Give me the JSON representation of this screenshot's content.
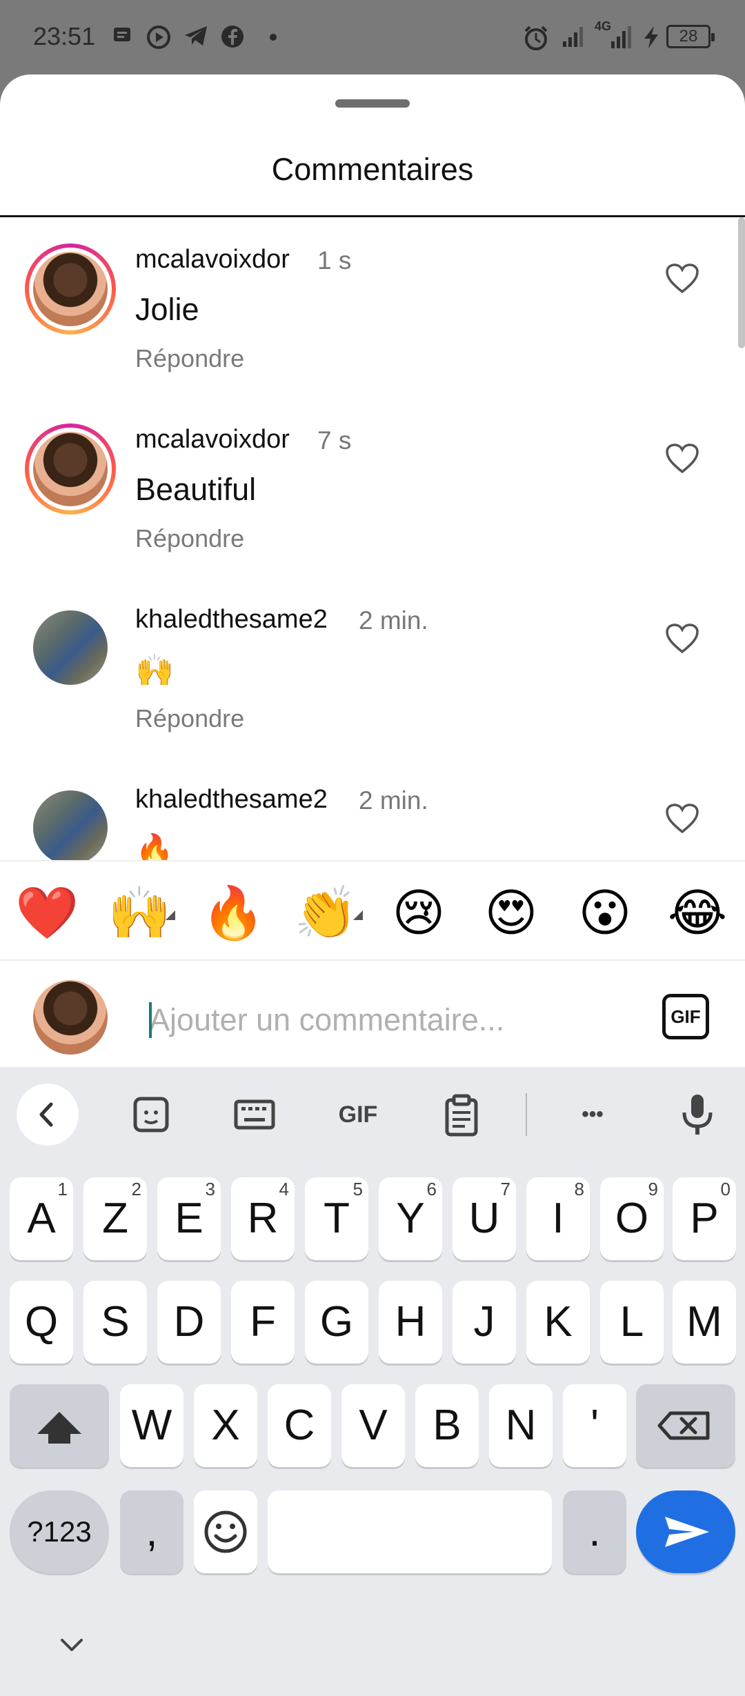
{
  "status_bar": {
    "time": "23:51",
    "battery": "28",
    "network": "4G"
  },
  "sheet": {
    "title": "Commentaires"
  },
  "comments": [
    {
      "username": "mcalavoixdor",
      "ago": "1 s",
      "text": "Jolie",
      "reply": "Répondre"
    },
    {
      "username": "mcalavoixdor",
      "ago": "7 s",
      "text": "Beautiful",
      "reply": "Répondre"
    },
    {
      "username": "khaledthesame2",
      "ago": "2 min.",
      "text": "🙌",
      "reply": "Répondre"
    },
    {
      "username": "khaledthesame2",
      "ago": "2 min.",
      "text": "🔥",
      "reply": ""
    }
  ],
  "emoji_bar": [
    "❤️",
    "🙌",
    "🔥",
    "👏",
    "😢",
    "😍",
    "😮",
    "😂"
  ],
  "comment_input": {
    "placeholder": "Ajouter un commentaire...",
    "gif_label": "GIF"
  },
  "keyboard": {
    "toolbar": {
      "gif_label": "GIF",
      "more_label": "•••"
    },
    "row1": [
      {
        "k": "A",
        "h": "1"
      },
      {
        "k": "Z",
        "h": "2"
      },
      {
        "k": "E",
        "h": "3"
      },
      {
        "k": "R",
        "h": "4"
      },
      {
        "k": "T",
        "h": "5"
      },
      {
        "k": "Y",
        "h": "6"
      },
      {
        "k": "U",
        "h": "7"
      },
      {
        "k": "I",
        "h": "8"
      },
      {
        "k": "O",
        "h": "9"
      },
      {
        "k": "P",
        "h": "0"
      }
    ],
    "row2": [
      "Q",
      "S",
      "D",
      "F",
      "G",
      "H",
      "J",
      "K",
      "L",
      "M"
    ],
    "row3": [
      "W",
      "X",
      "C",
      "V",
      "B",
      "N",
      "'"
    ],
    "symbols_label": "?123",
    "comma": ",",
    "period": "."
  },
  "colors": {
    "accent_blue": "#1f6fe3",
    "story_ring": "#d6249f"
  }
}
